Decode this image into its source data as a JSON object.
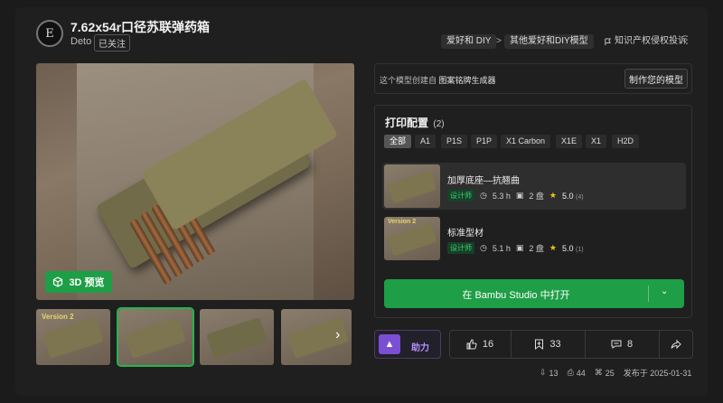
{
  "header": {
    "avatar_letter": "E",
    "title": "7.62x54r口径苏联弹药箱",
    "author": "Deto",
    "follow_status": "已关注",
    "breadcrumbs": [
      "爱好和 DIY",
      "其他爱好和DIY模型"
    ],
    "breadcrumb_separator": ">",
    "report_label": "知识产权侵权投诉",
    "more_icon": "⋮"
  },
  "gallery": {
    "btn_3d_label": "3D 预览",
    "thumbnail_labels": [
      "Version 2",
      "",
      "",
      ""
    ],
    "next_arrow": "›"
  },
  "creator_bar": {
    "prefix": "这个模型创建自",
    "source": "图案铭牌生成器",
    "make_button": "制作您的模型"
  },
  "print_profiles": {
    "title": "打印配置",
    "count": "(2)",
    "filters": [
      "全部",
      "A1",
      "P1S",
      "P1P",
      "X1 Carbon",
      "X1E",
      "X1",
      "H2D"
    ],
    "selected_filter": "全部",
    "items": [
      {
        "name": "加厚底座—抗翘曲",
        "tag": "设计师",
        "time": "5.3 h",
        "plates": "2 盘",
        "rating": "5.0",
        "reviews": "(4)",
        "thumb_label": ""
      },
      {
        "name": "标准型材",
        "tag": "设计师",
        "time": "5.1 h",
        "plates": "2 盘",
        "rating": "5.0",
        "reviews": "(1)",
        "thumb_label": "Version 2"
      }
    ],
    "open_button": "在 Bambu Studio 中打开",
    "open_dropdown_icon": "⌄"
  },
  "actions": {
    "boost_label": "助力",
    "likes": "16",
    "collects": "33",
    "comments": "8"
  },
  "footer": {
    "downloads": "13",
    "prints": "44",
    "remixes": "25",
    "published": "发布于 2025-01-31"
  }
}
